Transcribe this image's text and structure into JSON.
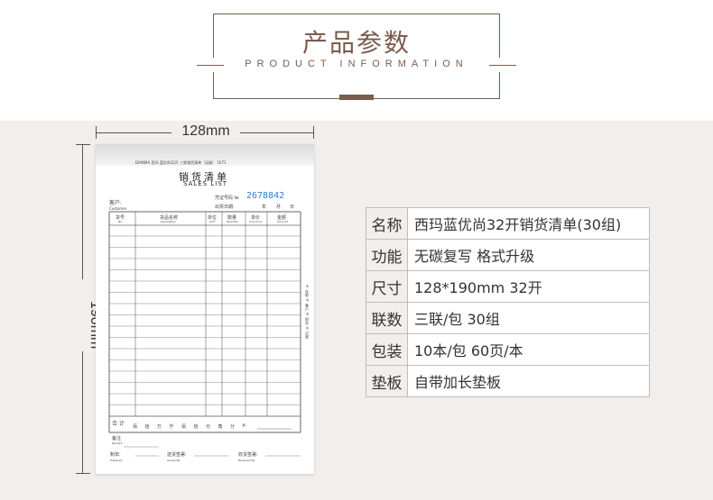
{
  "header": {
    "title_cn": "产品参数",
    "title_en": "PRODUCT INFORMATION"
  },
  "dimensions": {
    "width_label": "128mm",
    "height_label": "190mm"
  },
  "form": {
    "top_note": "DIANMA 西玛  蓝优尚32开 三联销货清单（无碳）  1071",
    "title_cn": "销货清单",
    "title_en": "SALES  LIST",
    "customer_label": "客户:",
    "customer_en": "Customer",
    "voucher_label": "凭证号码 №",
    "serial": "2678842",
    "date_label": "出票日期:",
    "date_units": [
      "年",
      "月",
      "日"
    ],
    "columns": [
      {
        "cn": "货号",
        "en": "No."
      },
      {
        "cn": "货品名称",
        "en": "Description"
      },
      {
        "cn": "单位",
        "en": "Unit"
      },
      {
        "cn": "数量",
        "en": "Quantity"
      },
      {
        "cn": "单价",
        "en": "Unit price"
      },
      {
        "cn": "金额",
        "en": "Amount"
      }
    ],
    "total_label": "合  计",
    "total_units": [
      "佰",
      "拾",
      "万",
      "仟",
      "佰",
      "拾",
      "元",
      "角",
      "分",
      "¥:"
    ],
    "remark_label": "备注",
    "remark_en": "Remark",
    "signers": [
      {
        "cn": "制单:",
        "en": "Prepared"
      },
      {
        "cn": "送货签署:",
        "en": "Issued By"
      },
      {
        "cn": "收货签署:",
        "en": "Received By"
      }
    ],
    "side_note": "① 存根 ② 客户 ③ 财务 ④ 记账"
  },
  "specs": [
    {
      "key": "名称",
      "value": "西玛蓝优尚32开销货清单(30组)"
    },
    {
      "key": "功能",
      "value": "无碳复写 格式升级"
    },
    {
      "key": "尺寸",
      "value": "128*190mm 32开"
    },
    {
      "key": "联数",
      "value": "三联/包  30组"
    },
    {
      "key": "包装",
      "value": "10本/包  60页/本"
    },
    {
      "key": "垫板",
      "value": "自带加长垫板"
    }
  ],
  "colors": {
    "accent": "#7a5c4c",
    "background": "#f2eeec",
    "serial": "#2b7dd6"
  }
}
